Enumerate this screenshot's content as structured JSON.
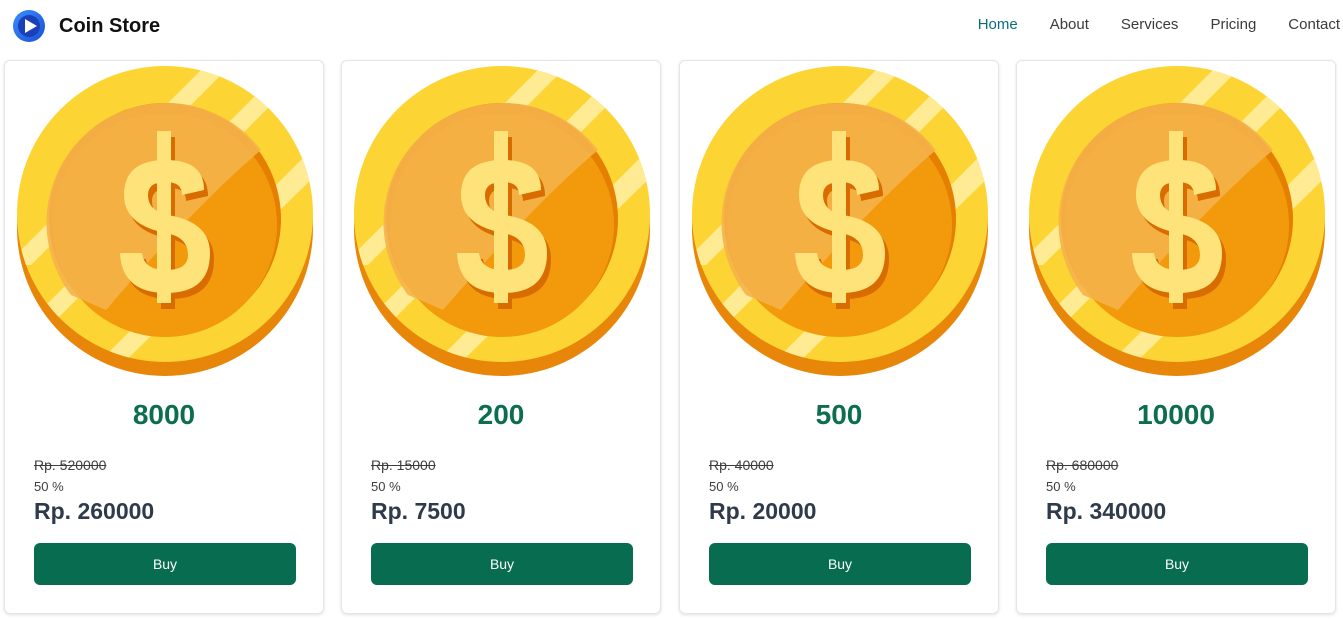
{
  "brand": {
    "name": "Coin Store",
    "logo_icon": "play-logo-icon"
  },
  "nav": {
    "active": "Home",
    "items": [
      "Home",
      "About",
      "Services",
      "Pricing",
      "Contact"
    ]
  },
  "colors": {
    "accent": "#086d50",
    "amount": "#0d6e4f",
    "nav_active": "#0a6e7a"
  },
  "cards": [
    {
      "icon": "gold-coin-icon",
      "amount": "8000",
      "old_price": "Rp. 520000",
      "discount": "50 %",
      "price": "Rp. 260000",
      "buy_label": "Buy"
    },
    {
      "icon": "gold-coin-icon",
      "amount": "200",
      "old_price": "Rp. 15000",
      "discount": "50 %",
      "price": "Rp. 7500",
      "buy_label": "Buy"
    },
    {
      "icon": "gold-coin-icon",
      "amount": "500",
      "old_price": "Rp. 40000",
      "discount": "50 %",
      "price": "Rp. 20000",
      "buy_label": "Buy"
    },
    {
      "icon": "gold-coin-icon",
      "amount": "10000",
      "old_price": "Rp. 680000",
      "discount": "50 %",
      "price": "Rp. 340000",
      "buy_label": "Buy"
    }
  ]
}
